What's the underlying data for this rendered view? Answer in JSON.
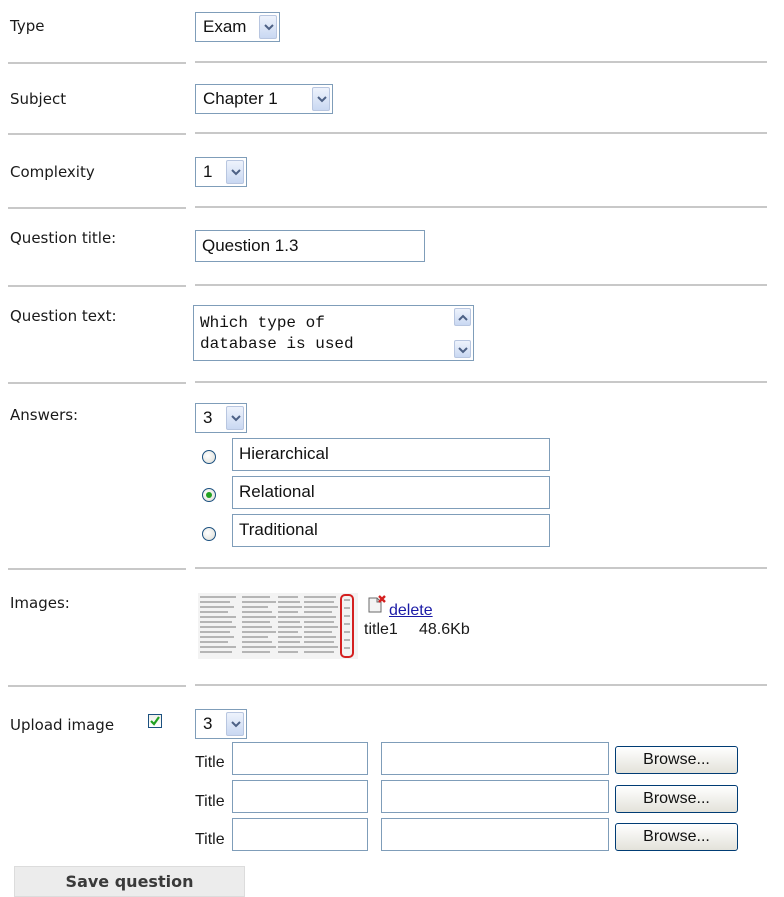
{
  "form": {
    "type": {
      "label": "Type",
      "value": "Exam"
    },
    "subject": {
      "label": "Subject",
      "value": "Chapter 1"
    },
    "complexity": {
      "label": "Complexity",
      "value": "1"
    },
    "question_title": {
      "label": "Question title:",
      "value": "Question 1.3"
    },
    "question_text": {
      "label": "Question text:",
      "lines": [
        "Which type of",
        "database is used"
      ]
    },
    "answers": {
      "label": "Answers:",
      "count": "3",
      "options": [
        {
          "text": "Hierarchical",
          "selected": false
        },
        {
          "text": "Relational",
          "selected": true
        },
        {
          "text": "Traditional",
          "selected": false
        }
      ]
    },
    "images": {
      "label": "Images:",
      "delete_label": "delete",
      "image_title": "title1",
      "image_size": "48.6Kb"
    },
    "upload": {
      "label": "Upload image",
      "checked": true,
      "count": "3",
      "rows": [
        {
          "title_label": "Title",
          "title_value": "",
          "file_value": "",
          "browse_label": "Browse..."
        },
        {
          "title_label": "Title",
          "title_value": "",
          "file_value": "",
          "browse_label": "Browse..."
        },
        {
          "title_label": "Title",
          "title_value": "",
          "file_value": "",
          "browse_label": "Browse..."
        }
      ]
    },
    "save_label": "Save question"
  },
  "colors": {
    "border": "#7f9db9",
    "rule": "#c8c8c8",
    "radio_selected": "#21a121",
    "checkbox_check": "#21a121",
    "link": "#1a1aa6",
    "delete_mark": "#d42020"
  },
  "icons": {
    "dropdown": "chevron-down-icon",
    "scroll_up": "chevron-up-icon",
    "scroll_down": "chevron-down-icon",
    "delete": "delete-file-icon",
    "checkbox": "checkmark-icon"
  }
}
